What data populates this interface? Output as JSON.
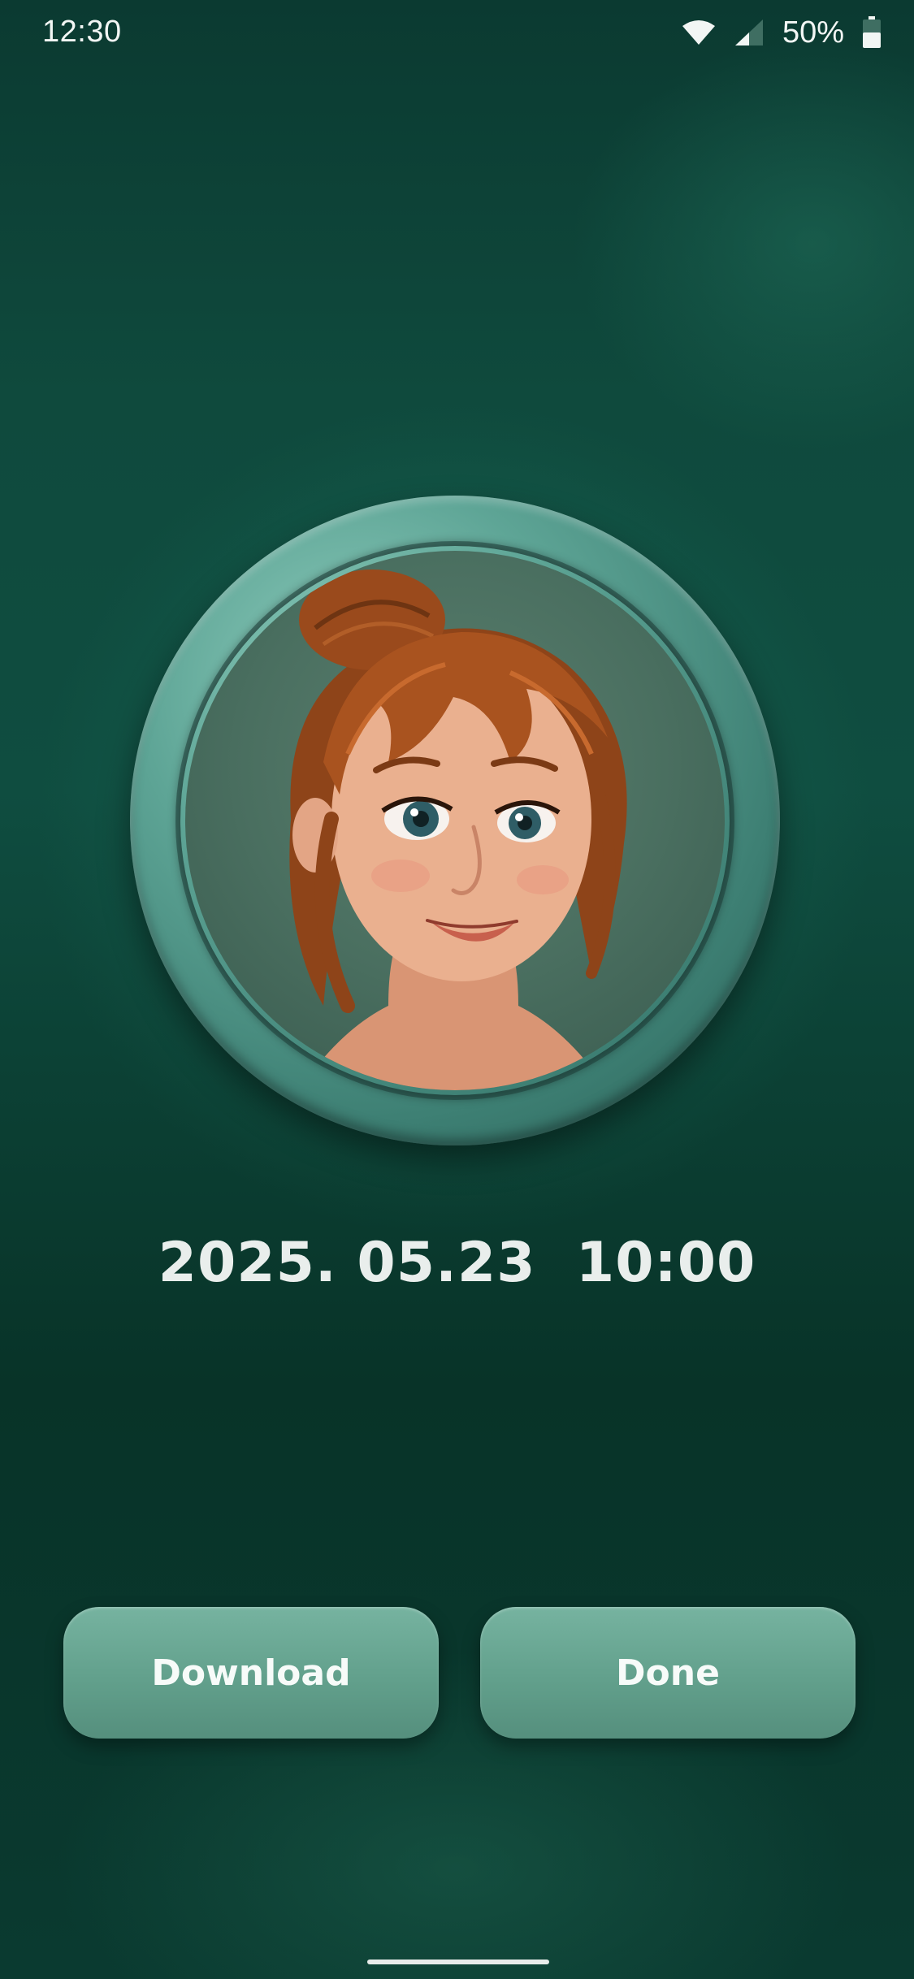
{
  "status_bar": {
    "time": "12:30",
    "battery_percent": "50%",
    "battery_level": 0.5,
    "icons": [
      "wifi-icon",
      "signal-icon",
      "battery-icon"
    ]
  },
  "avatar": {
    "description_icon": "portrait-avatar"
  },
  "datetime": {
    "text": "2025. 05.23  10:00"
  },
  "actions": {
    "download_label": "Download",
    "done_label": "Done"
  },
  "colors": {
    "background": "#0f4a3d",
    "button": "#6aa893",
    "ring": "#5ea596",
    "text": "#e9eeec"
  }
}
